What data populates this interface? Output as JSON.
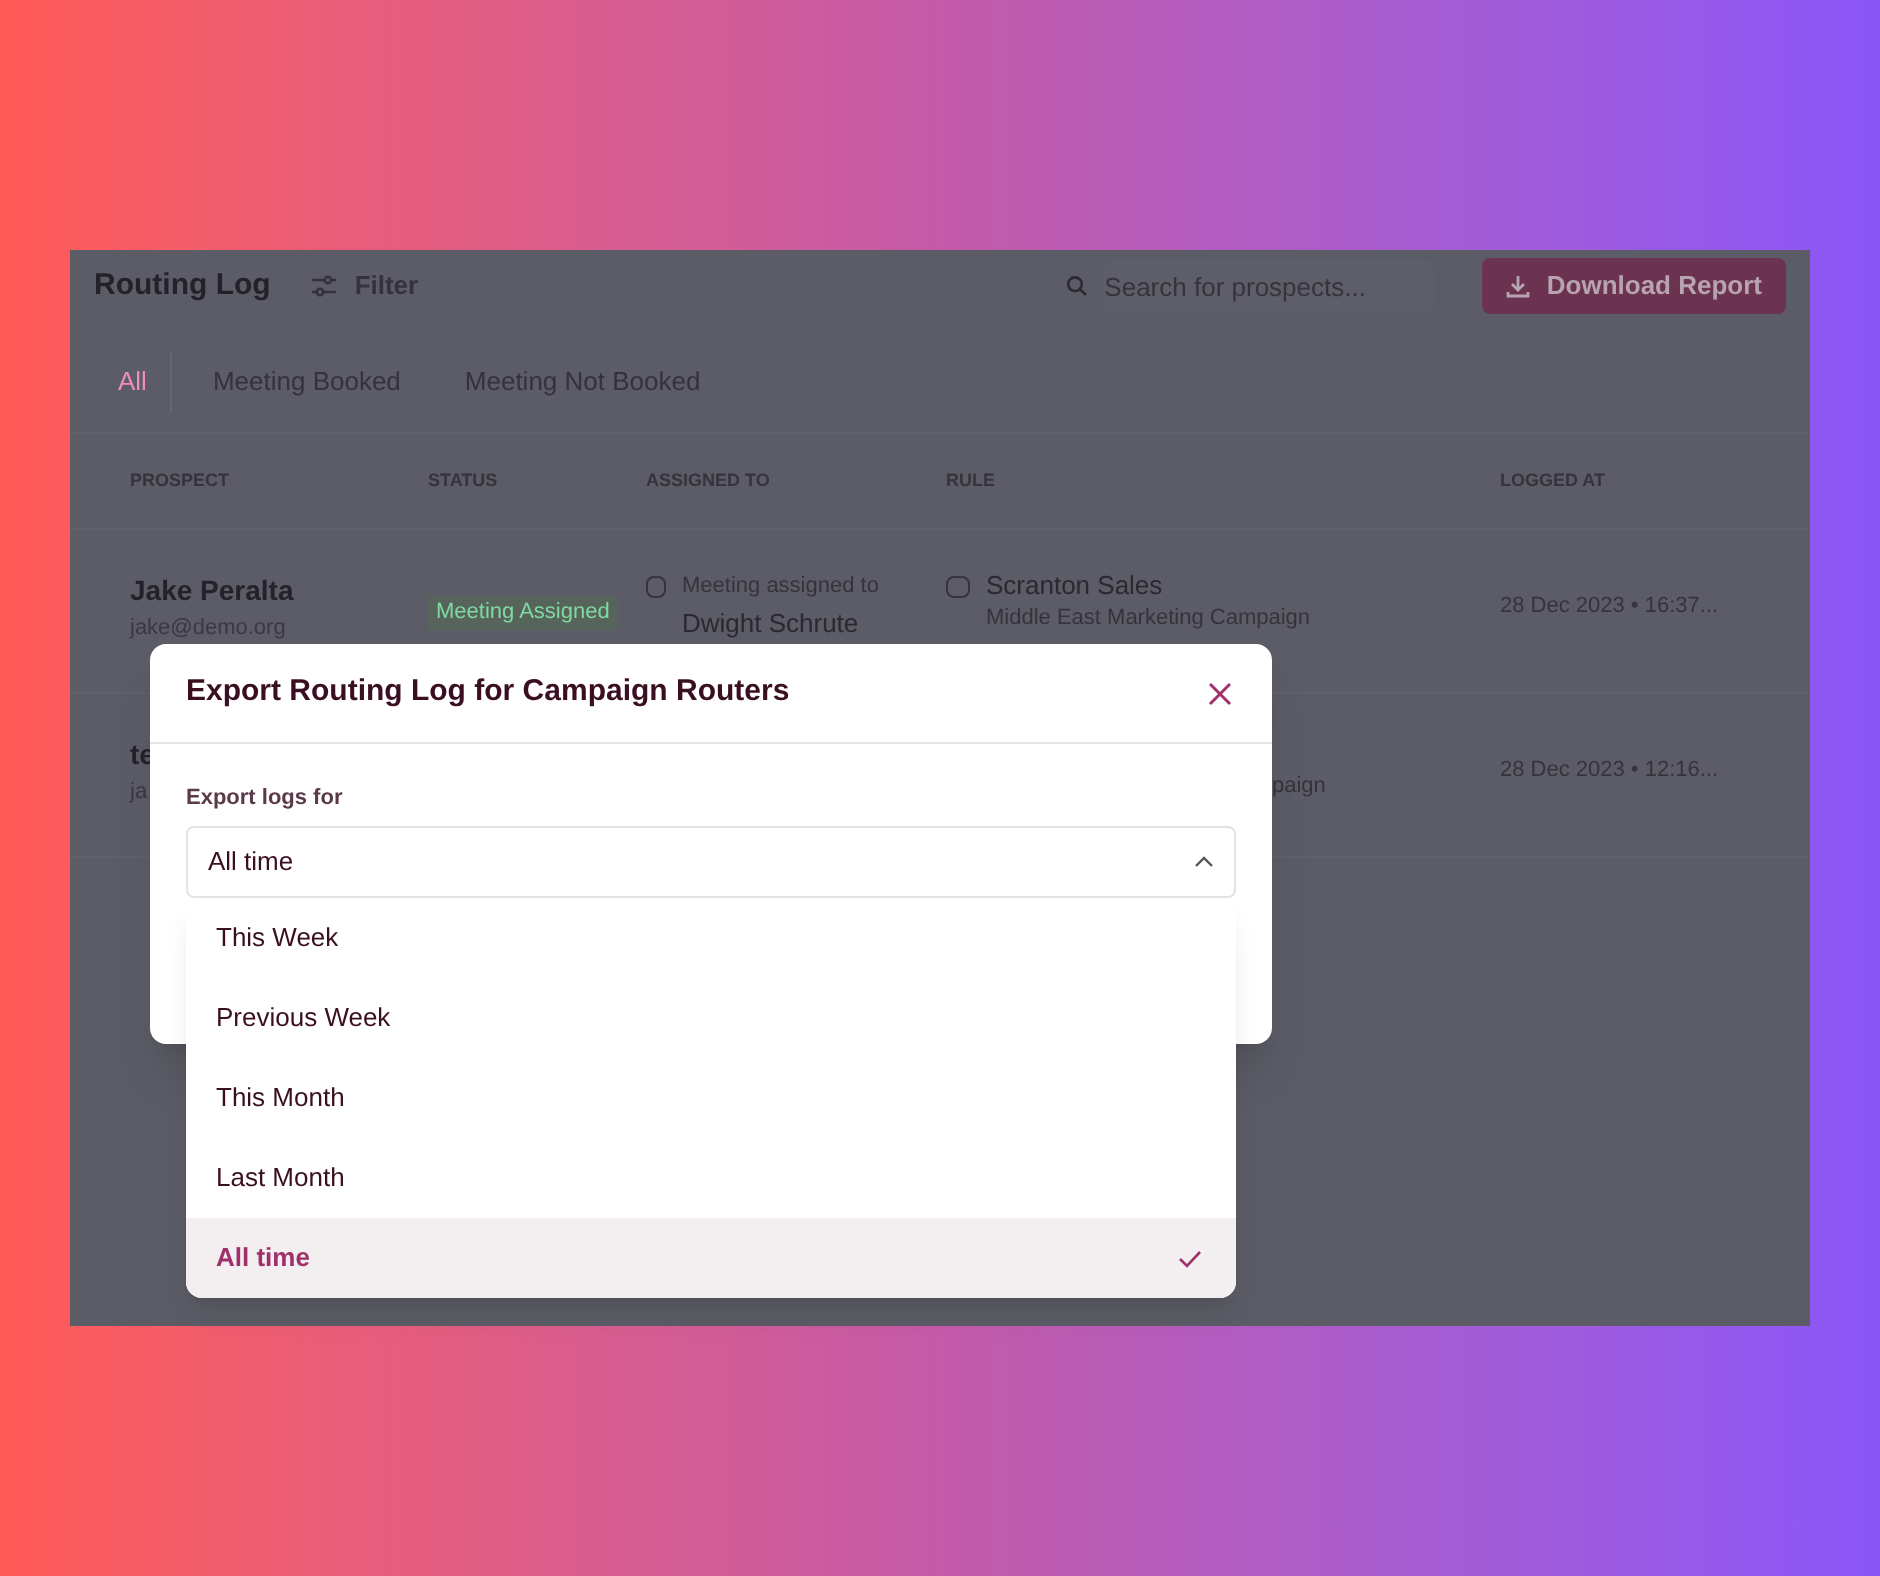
{
  "header": {
    "title": "Routing Log",
    "filter_label": "Filter",
    "search": {
      "placeholder": "Search for prospects..."
    },
    "download_button": "Download Report"
  },
  "tabs": [
    {
      "label": "All",
      "selected": true
    },
    {
      "label": "Meeting Booked",
      "selected": false
    },
    {
      "label": "Meeting Not Booked",
      "selected": false
    }
  ],
  "table": {
    "columns": [
      "PROSPECT",
      "STATUS",
      "ASSIGNED TO",
      "RULE",
      "LOGGED AT"
    ],
    "rows": [
      {
        "name": "Jake Peralta",
        "email": "jake@demo.org",
        "status": "Meeting Assigned",
        "assigned_label": "Meeting assigned to",
        "assigned_to": "Dwight Schrute",
        "rule": "Scranton Sales",
        "campaign": "Middle East Marketing Campaign",
        "logged_at": "28 Dec 2023 • 16:37..."
      },
      {
        "name": "te",
        "email": "ja",
        "campaign": "paign",
        "logged_at": "28 Dec 2023 • 12:16..."
      }
    ]
  },
  "modal": {
    "title": "Export Routing Log for Campaign Routers",
    "field_label": "Export logs for",
    "value": "All time",
    "options": [
      {
        "label": "This Week",
        "selected": false
      },
      {
        "label": "Previous Week",
        "selected": false
      },
      {
        "label": "This Month",
        "selected": false
      },
      {
        "label": "Last Month",
        "selected": false
      },
      {
        "label": "All time",
        "selected": true
      }
    ]
  }
}
